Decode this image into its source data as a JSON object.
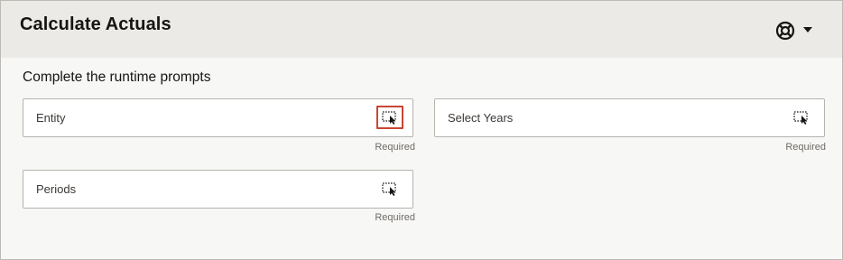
{
  "header": {
    "title": "Calculate Actuals",
    "help_icon": "lifebuoy-icon",
    "menu_icon": "caret-down-icon"
  },
  "subtitle": "Complete the runtime prompts",
  "fields": [
    {
      "label": "Entity",
      "helper": "Required",
      "icon": "member-selector-icon",
      "highlighted": true,
      "highlight_color": "#c74634"
    },
    {
      "label": "Select Years",
      "helper": "Required",
      "icon": "member-selector-icon"
    },
    {
      "label": "Periods",
      "helper": "Required",
      "icon": "member-selector-icon"
    }
  ]
}
